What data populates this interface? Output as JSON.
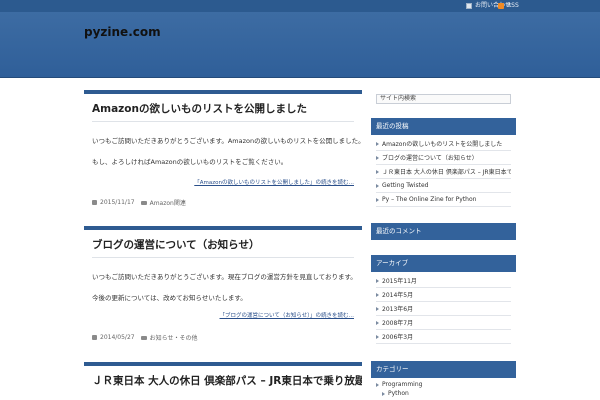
{
  "topbar": {
    "contact_label": "お問い合わせ",
    "rss_label": "RSS"
  },
  "header": {
    "site_title": "pyzine.com"
  },
  "posts": [
    {
      "title": "Amazonの欲しいものリストを公開しました",
      "paragraphs": [
        "いつもご訪問いただきありがとうございます。Amazonの欲しいものリストを公開しました。",
        "もし、よろしければAmazonの欲しいものリストをご覧ください。"
      ],
      "more_link": "「Amazonの欲しいものリストを公開しました」の続きを読む…",
      "date": "2015/11/17",
      "category": "Amazon関連"
    },
    {
      "title": "ブログの運営について（お知らせ）",
      "paragraphs": [
        "いつもご訪問いただきありがとうございます。現在ブログの運営方針を見直しております。",
        "今後の更新については、改めてお知らせいたします。"
      ],
      "more_link": "「ブログの運営について（お知らせ）」の続きを読む…",
      "date": "2014/05/27",
      "category": "お知らせ・その他"
    },
    {
      "title": "ＪＲ東日本 大人の休日 倶楽部パス – JR東日本で乗り放題の旅"
    }
  ],
  "sidebar": {
    "search_placeholder": "サイト内検索",
    "recent": {
      "heading": "最近の投稿",
      "items": [
        "Amazonの欲しいものリストを公開しました",
        "ブログの運営について（お知らせ）",
        "ＪＲ東日本 大人の休日 倶楽部パス – JR東日本で乗り放題の旅",
        "Getting Twisted",
        "Py – The Online Zine for Python"
      ]
    },
    "comments": {
      "heading": "最近のコメント"
    },
    "archives": {
      "heading": "アーカイブ",
      "items": [
        "2015年11月",
        "2014年5月",
        "2013年6月",
        "2008年7月",
        "2006年3月"
      ]
    },
    "categories": {
      "heading": "カテゴリー",
      "items": [
        "Programming",
        "Python"
      ]
    }
  }
}
